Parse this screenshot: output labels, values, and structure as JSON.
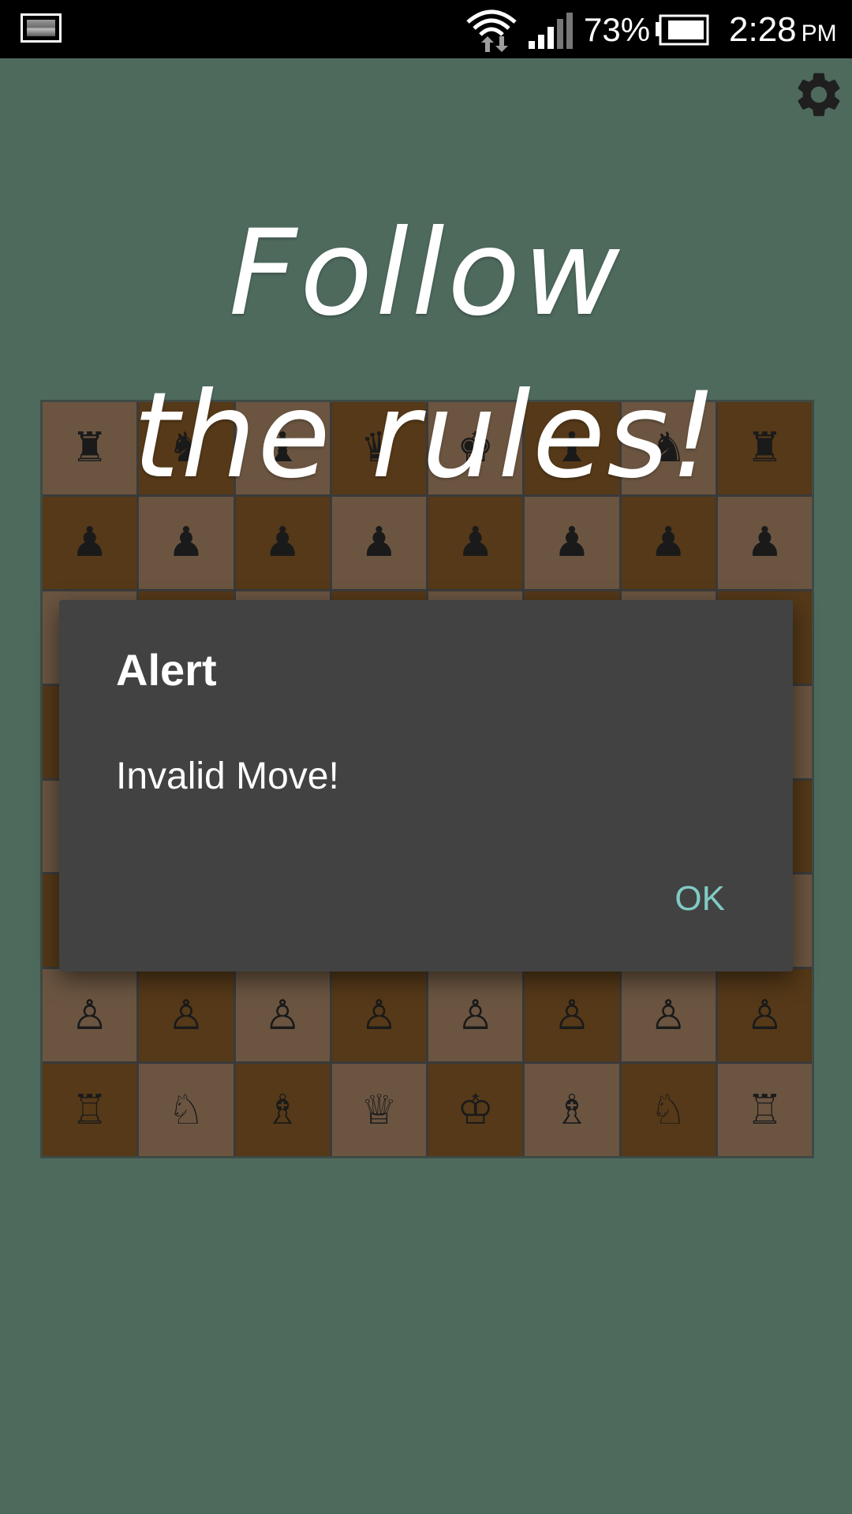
{
  "status_bar": {
    "battery_percent": "73%",
    "time": "2:28",
    "ampm": "PM",
    "icons": [
      "gallery-icon",
      "wifi-icon",
      "signal-icon",
      "battery-icon"
    ]
  },
  "header": {
    "settings_icon": "gear-icon",
    "title_line1": "Follow",
    "title_line2": "the rules!"
  },
  "board": {
    "rows": [
      [
        "♜",
        "♞",
        "♝",
        "♛",
        "♚",
        "♝",
        "♞",
        "♜"
      ],
      [
        "♟",
        "♟",
        "♟",
        "♟",
        "♟",
        "♟",
        "♟",
        "♟"
      ],
      [
        "",
        "",
        "",
        "",
        "",
        "",
        "",
        ""
      ],
      [
        "",
        "",
        "",
        "",
        "",
        "",
        "",
        ""
      ],
      [
        "",
        "",
        "",
        "",
        "",
        "",
        "",
        ""
      ],
      [
        "",
        "",
        "",
        "",
        "",
        "",
        "",
        ""
      ],
      [
        "♙",
        "♙",
        "♙",
        "♙",
        "♙",
        "♙",
        "♙",
        "♙"
      ],
      [
        "♖",
        "♘",
        "♗",
        "♕",
        "♔",
        "♗",
        "♘",
        "♖"
      ]
    ],
    "colors": {
      "light": "#6b5541",
      "dark": "#553918"
    }
  },
  "dialog": {
    "title": "Alert",
    "message": "Invalid Move!",
    "ok_label": "OK"
  },
  "colors": {
    "background": "#4e6a5d",
    "dialog_bg": "#424242",
    "accent": "#80cbc4"
  }
}
